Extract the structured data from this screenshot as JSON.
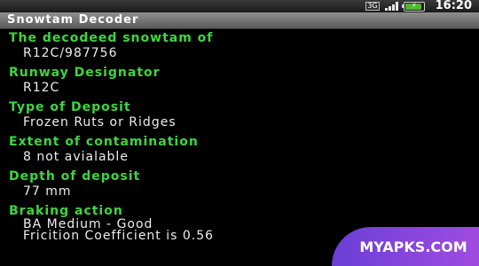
{
  "status_bar": {
    "network_badge": "3G",
    "signal_icon": "signal-bars-icon",
    "battery_icon": "battery-charging-icon",
    "battery_level": 0.9,
    "time": "16:20"
  },
  "app": {
    "title": "Snowtam Decoder"
  },
  "fields": [
    {
      "label": "The decodeed snowtam of",
      "value": "R12C/987756"
    },
    {
      "label": "Runway Designator",
      "value": "R12C"
    },
    {
      "label": "Type of Deposit",
      "value": "Frozen Ruts or Ridges"
    },
    {
      "label": "Extent of contamination",
      "value": "8 not avialable"
    },
    {
      "label": "Depth of deposit",
      "value": "77 mm"
    },
    {
      "label": "Braking action",
      "value_lines": [
        "BA Medium  - Good",
        "Fricition Coefficient is 0.56"
      ]
    }
  ],
  "watermark": {
    "text": "MYAPKS.COM"
  },
  "colors": {
    "label_green": "#3fd53f",
    "value_text": "#ededed",
    "background": "#000000",
    "watermark_purple": "#8a45dc"
  }
}
